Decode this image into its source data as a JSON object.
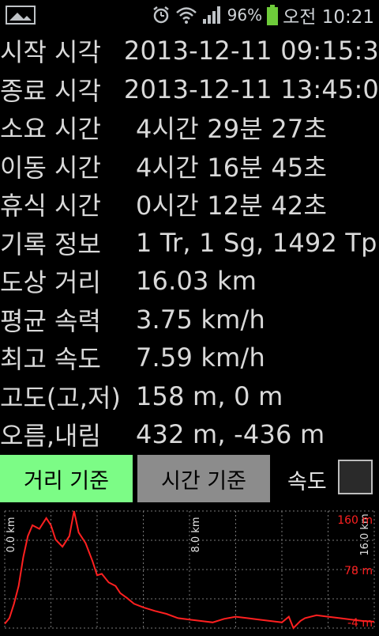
{
  "status_bar": {
    "battery_percent": "96%",
    "time": "오전 10:21",
    "icons": [
      "gallery-icon",
      "alarm-clock-icon",
      "wifi-icon",
      "signal-icon",
      "battery-icon"
    ]
  },
  "track_info": {
    "rows": [
      {
        "label": "시작 시각",
        "value": "2013-12-11 09:15:3"
      },
      {
        "label": "종료 시각",
        "value": "2013-12-11 13:45:0"
      },
      {
        "label": "소요 시간",
        "value": "4시간 29분 27초"
      },
      {
        "label": "이동 시간",
        "value": "4시간 16분 45초"
      },
      {
        "label": "휴식 시간",
        "value": "0시간 12분 42초"
      },
      {
        "label": "기록 정보",
        "value": "1 Tr, 1 Sg, 1492 Tp"
      },
      {
        "label": "도상 거리",
        "value": "16.03 km"
      },
      {
        "label": "평균 속력",
        "value": "3.75 km/h"
      },
      {
        "label": "최고 속도",
        "value": "7.59 km/h"
      },
      {
        "label": "고도(고,저)",
        "value": "158 m, 0 m"
      },
      {
        "label": "오름,내림",
        "value": "432 m, -436 m"
      }
    ]
  },
  "controls": {
    "distance_button": "거리 기준",
    "time_button": "시간 기준",
    "speed_label": "속도",
    "speed_checked": false
  },
  "chart_data": {
    "type": "line",
    "x_tick_labels": [
      "0.0 km",
      "8.0 km",
      "16.0 km"
    ],
    "y_tick_labels": [
      "160 m",
      "78 m",
      "-4 m"
    ],
    "ylim": [
      -4,
      160
    ],
    "xlim": [
      0,
      16
    ],
    "grid": true,
    "line_color": "#ff2020",
    "series": [
      {
        "x": [
          0,
          0.2,
          0.4,
          0.6,
          0.8,
          1.0,
          1.2,
          1.5,
          1.8,
          2.0,
          2.2,
          2.5,
          2.8,
          3.0,
          3.2,
          3.5,
          3.8,
          4.0,
          4.2,
          4.5,
          4.8,
          5.0,
          5.3,
          5.6,
          6.0,
          6.5,
          7.0,
          7.5,
          8.0,
          8.5,
          9.0,
          9.5,
          10.0,
          10.5,
          11.0,
          11.5,
          12.0,
          12.3,
          12.5,
          12.8,
          13.0,
          13.5,
          14.0,
          14.5,
          15.0,
          15.5,
          16.0
        ],
        "y": [
          2,
          10,
          30,
          55,
          95,
          125,
          140,
          135,
          150,
          140,
          120,
          110,
          125,
          160,
          130,
          115,
          90,
          70,
          72,
          60,
          55,
          45,
          38,
          30,
          25,
          20,
          16,
          10,
          8,
          6,
          4,
          9,
          12,
          10,
          8,
          6,
          4,
          12,
          -4,
          6,
          10,
          14,
          12,
          10,
          8,
          6,
          5
        ]
      }
    ]
  }
}
